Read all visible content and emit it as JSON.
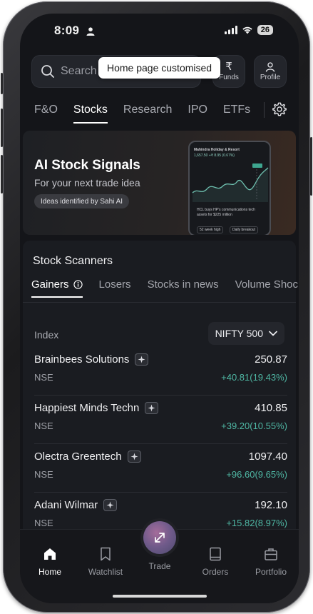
{
  "status_bar": {
    "time": "8:09",
    "battery": "26"
  },
  "header": {
    "search_placeholder": "Search fu",
    "funds_label": "Funds",
    "profile_label": "Profile",
    "toast": "Home page customised"
  },
  "top_tabs": [
    {
      "label": "F&O"
    },
    {
      "label": "Stocks"
    },
    {
      "label": "Research"
    },
    {
      "label": "IPO"
    },
    {
      "label": "ETFs"
    }
  ],
  "banner": {
    "title": "AI Stock Signals",
    "subtitle": "For your next trade idea",
    "pill": "Ideas identified by Sahi AI",
    "mini_card": {
      "stock_name": "Mahindra Holiday & Resort",
      "price_line": "1,657.50  +₹ 8.95 (0.67%)",
      "news_line_1": "HCL buys HP's communications tech",
      "news_line_2": "assets for $225 million",
      "chip_1": "52 week high",
      "chip_2": "Daily breakout"
    }
  },
  "scanners": {
    "title": "Stock Scanners",
    "tabs": [
      {
        "label": "Gainers"
      },
      {
        "label": "Losers"
      },
      {
        "label": "Stocks in news"
      },
      {
        "label": "Volume Shock"
      }
    ],
    "index_label": "Index",
    "index_value": "NIFTY 500",
    "rows": [
      {
        "name": "Brainbees Solutions",
        "exchange": "NSE",
        "price": "250.87",
        "change": "+40.81(19.43%)"
      },
      {
        "name": "Happiest Minds Techn",
        "exchange": "NSE",
        "price": "410.85",
        "change": "+39.20(10.55%)"
      },
      {
        "name": "Olectra Greentech",
        "exchange": "NSE",
        "price": "1097.40",
        "change": "+96.60(9.65%)"
      },
      {
        "name": "Adani Wilmar",
        "exchange": "NSE",
        "price": "192.10",
        "change": "+15.82(8.97%)"
      }
    ]
  },
  "bottom_nav": {
    "home": "Home",
    "watchlist": "Watchlist",
    "trade": "Trade",
    "orders": "Orders",
    "portfolio": "Portfolio"
  },
  "colors": {
    "background": "#141519",
    "positive": "#4fb7a4",
    "accent": "#a46c9a"
  }
}
